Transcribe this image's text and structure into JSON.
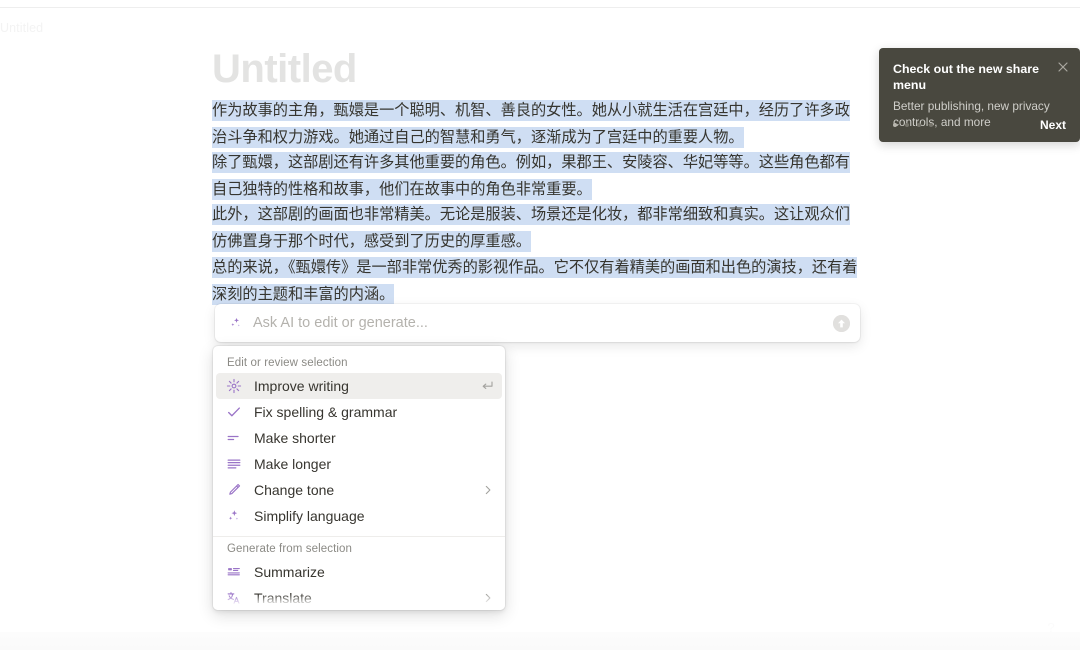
{
  "breadcrumb": {
    "label": "Untitled"
  },
  "document": {
    "title": "Untitled",
    "paragraphs": [
      "作为故事的主角，甄嬛是一个聪明、机智、善良的女性。她从小就生活在宫廷中，经历了许多政治斗争和权力游戏。她通过自己的智慧和勇气，逐渐成为了宫廷中的重要人物。",
      "除了甄嬛，这部剧还有许多其他重要的角色。例如，果郡王、安陵容、华妃等等。这些角色都有自己独特的性格和故事，他们在故事中的角色非常重要。",
      "此外，这部剧的画面也非常精美。无论是服装、场景还是化妆，都非常细致和真实。这让观众们仿佛置身于那个时代，感受到了历史的厚重感。",
      "总的来说，《甄嬛传》是一部非常优秀的影视作品。它不仅有着精美的画面和出色的演技，还有着深刻的主题和丰富的内涵。"
    ],
    "selection_highlight_color": "#cfdef3"
  },
  "ai_bar": {
    "placeholder": "Ask AI to edit or generate...",
    "value": "",
    "lead_icon": "sparkle-icon",
    "send_icon": "arrow-up-circle-icon"
  },
  "ai_menu": {
    "sections": [
      {
        "label": "Edit or review selection",
        "items": [
          {
            "label": "Improve writing",
            "icon": "sparkle-burst-icon",
            "active": true,
            "right": "return-key-icon"
          },
          {
            "label": "Fix spelling & grammar",
            "icon": "check-icon",
            "active": false,
            "right": ""
          },
          {
            "label": "Make shorter",
            "icon": "make-shorter-icon",
            "active": false,
            "right": ""
          },
          {
            "label": "Make longer",
            "icon": "make-longer-icon",
            "active": false,
            "right": ""
          },
          {
            "label": "Change tone",
            "icon": "pen-icon",
            "active": false,
            "right": "chevron-right-icon"
          },
          {
            "label": "Simplify language",
            "icon": "sparkle-icon",
            "active": false,
            "right": ""
          }
        ]
      },
      {
        "label": "Generate from selection",
        "items": [
          {
            "label": "Summarize",
            "icon": "summarize-icon",
            "active": false,
            "right": ""
          },
          {
            "label": "Translate",
            "icon": "translate-icon",
            "active": false,
            "right": "chevron-right-icon"
          }
        ]
      }
    ],
    "accent_color": "#9a74c7"
  },
  "toast": {
    "title": "Check out the new share menu",
    "body": "Better publishing, new privacy controls, and more",
    "next_label": "Next",
    "close_icon": "close-icon",
    "dots_total": 4,
    "dots_active_index": 0,
    "background_color": "#49483f"
  },
  "help": {
    "label": "?"
  }
}
